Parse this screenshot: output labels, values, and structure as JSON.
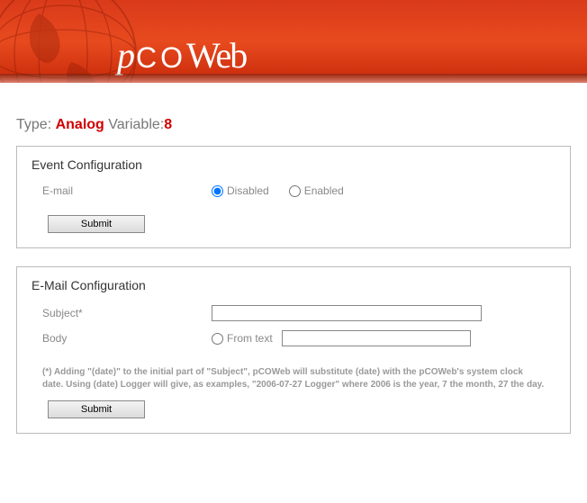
{
  "brand": {
    "logo_text": "pCOWeb"
  },
  "type_line": {
    "type_label": "Type:",
    "type_value": "Analog",
    "variable_label": "Variable:",
    "variable_value": "8"
  },
  "event_config": {
    "title": "Event Configuration",
    "email_label": "E-mail",
    "disabled_label": "Disabled",
    "enabled_label": "Enabled",
    "selected": "disabled",
    "submit_label": "Submit"
  },
  "email_config": {
    "title": "E-Mail Configuration",
    "subject_label": "Subject*",
    "subject_value": "",
    "body_label": "Body",
    "from_text_label": "From text",
    "from_text_value": "",
    "body_selected": "from_text",
    "footnote": "(*) Adding \"(date)\" to the initial part of \"Subject\", pCOWeb will substitute (date) with the pCOWeb's system clock date. Using (date) Logger will give, as examples, \"2006-07-27 Logger\" where 2006 is the year, 7 the month, 27 the day.",
    "submit_label": "Submit"
  }
}
